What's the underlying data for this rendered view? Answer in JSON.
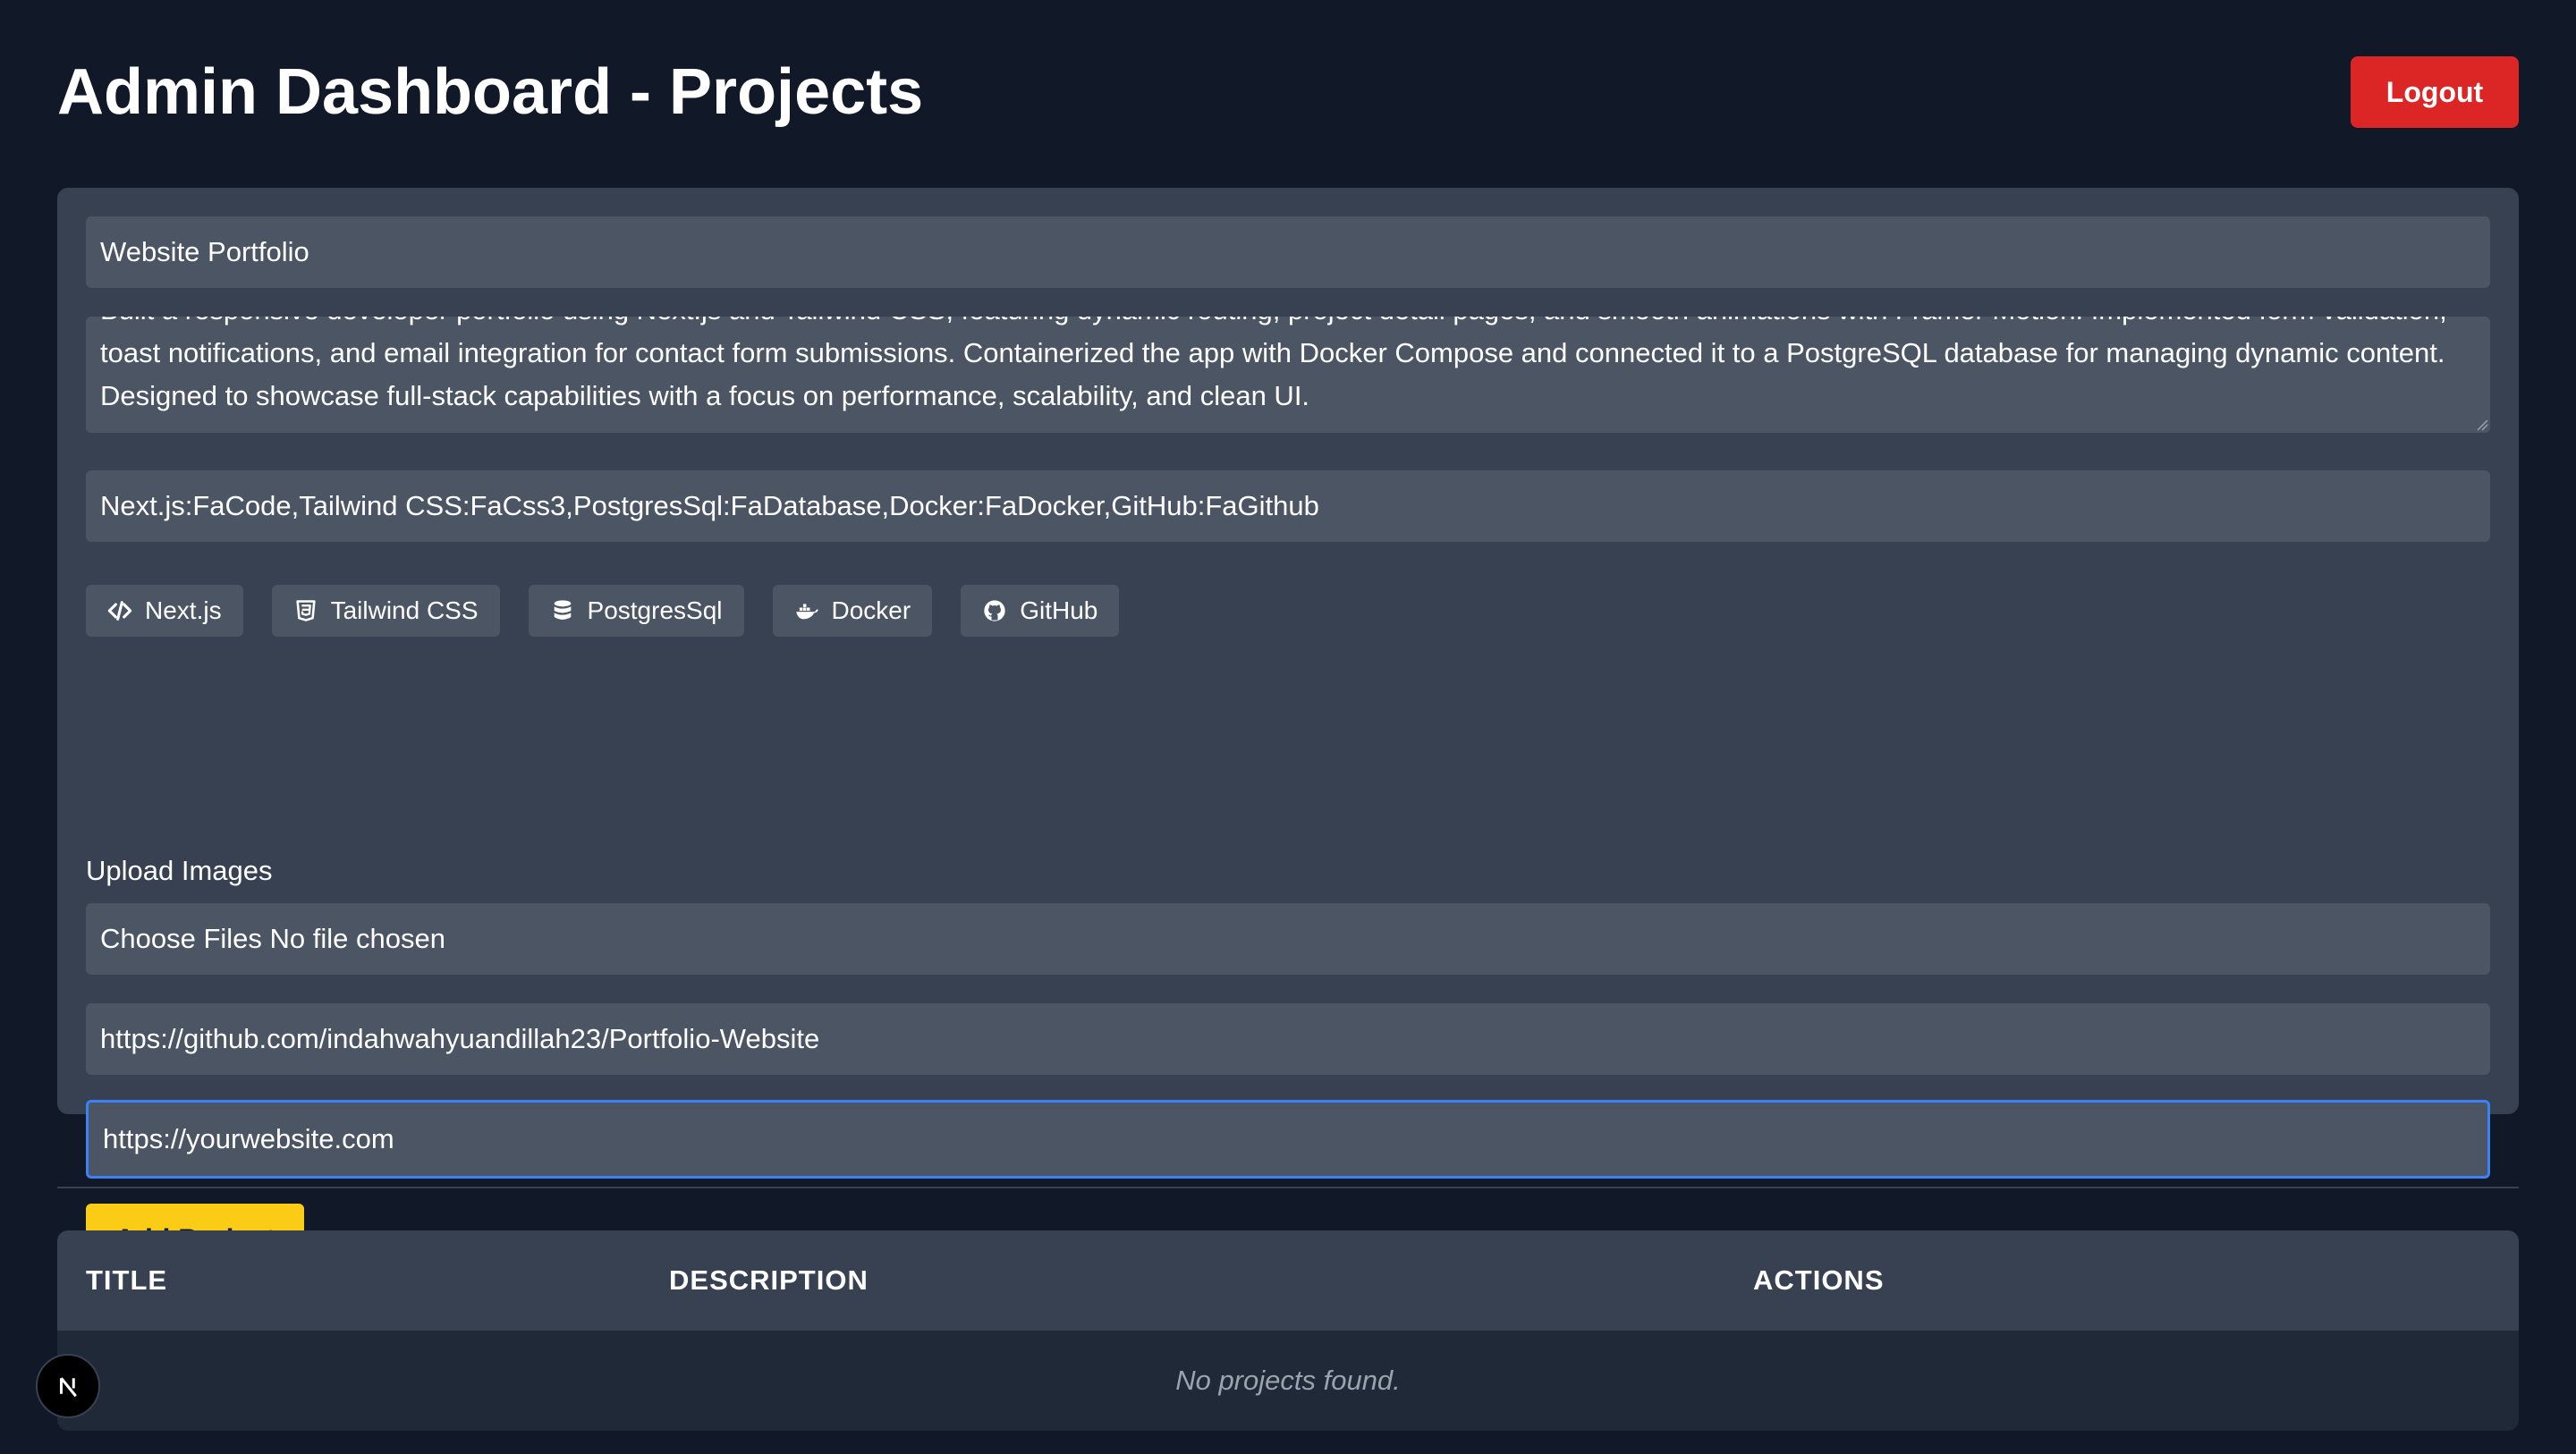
{
  "header": {
    "title": "Admin Dashboard - Projects",
    "logout_label": "Logout"
  },
  "form": {
    "title_value": "Website Portfolio",
    "description_value": "Built a responsive developer portfolio using Next.js and Tailwind CSS, featuring dynamic routing, project detail pages, and smooth animations with Framer Motion. Implemented form validation, toast notifications, and email integration for contact form submissions. Containerized the app with Docker Compose and connected it to a PostgreSQL database for managing dynamic content. Designed to showcase full-stack capabilities with a focus on performance, scalability, and clean UI.",
    "tech_value": "Next.js:FaCode,Tailwind CSS:FaCss3,PostgresSql:FaDatabase,Docker:FaDocker,GitHub:FaGithub",
    "tech_chips": [
      {
        "label": "Next.js",
        "icon": "code-icon"
      },
      {
        "label": "Tailwind CSS",
        "icon": "css3-icon"
      },
      {
        "label": "PostgresSql",
        "icon": "database-icon"
      },
      {
        "label": "Docker",
        "icon": "docker-icon"
      },
      {
        "label": "GitHub",
        "icon": "github-icon"
      }
    ],
    "upload_label": "Upload Images",
    "file_input_text": "Choose Files No file chosen",
    "github_value": "https://github.com/indahwahyuandillah23/Portfolio-Website",
    "live_placeholder": "https://yourwebsite.com",
    "submit_label": "Add Project"
  },
  "table": {
    "columns": [
      "TITLE",
      "DESCRIPTION",
      "ACTIONS"
    ],
    "empty_message": "No projects found."
  },
  "colors": {
    "background": "#111827",
    "card": "#374151",
    "input": "#4b5563",
    "logout": "#dc2626",
    "submit": "#facc15",
    "focus": "#3b82f6"
  },
  "badge": {
    "icon": "nextjs-logo-icon"
  }
}
